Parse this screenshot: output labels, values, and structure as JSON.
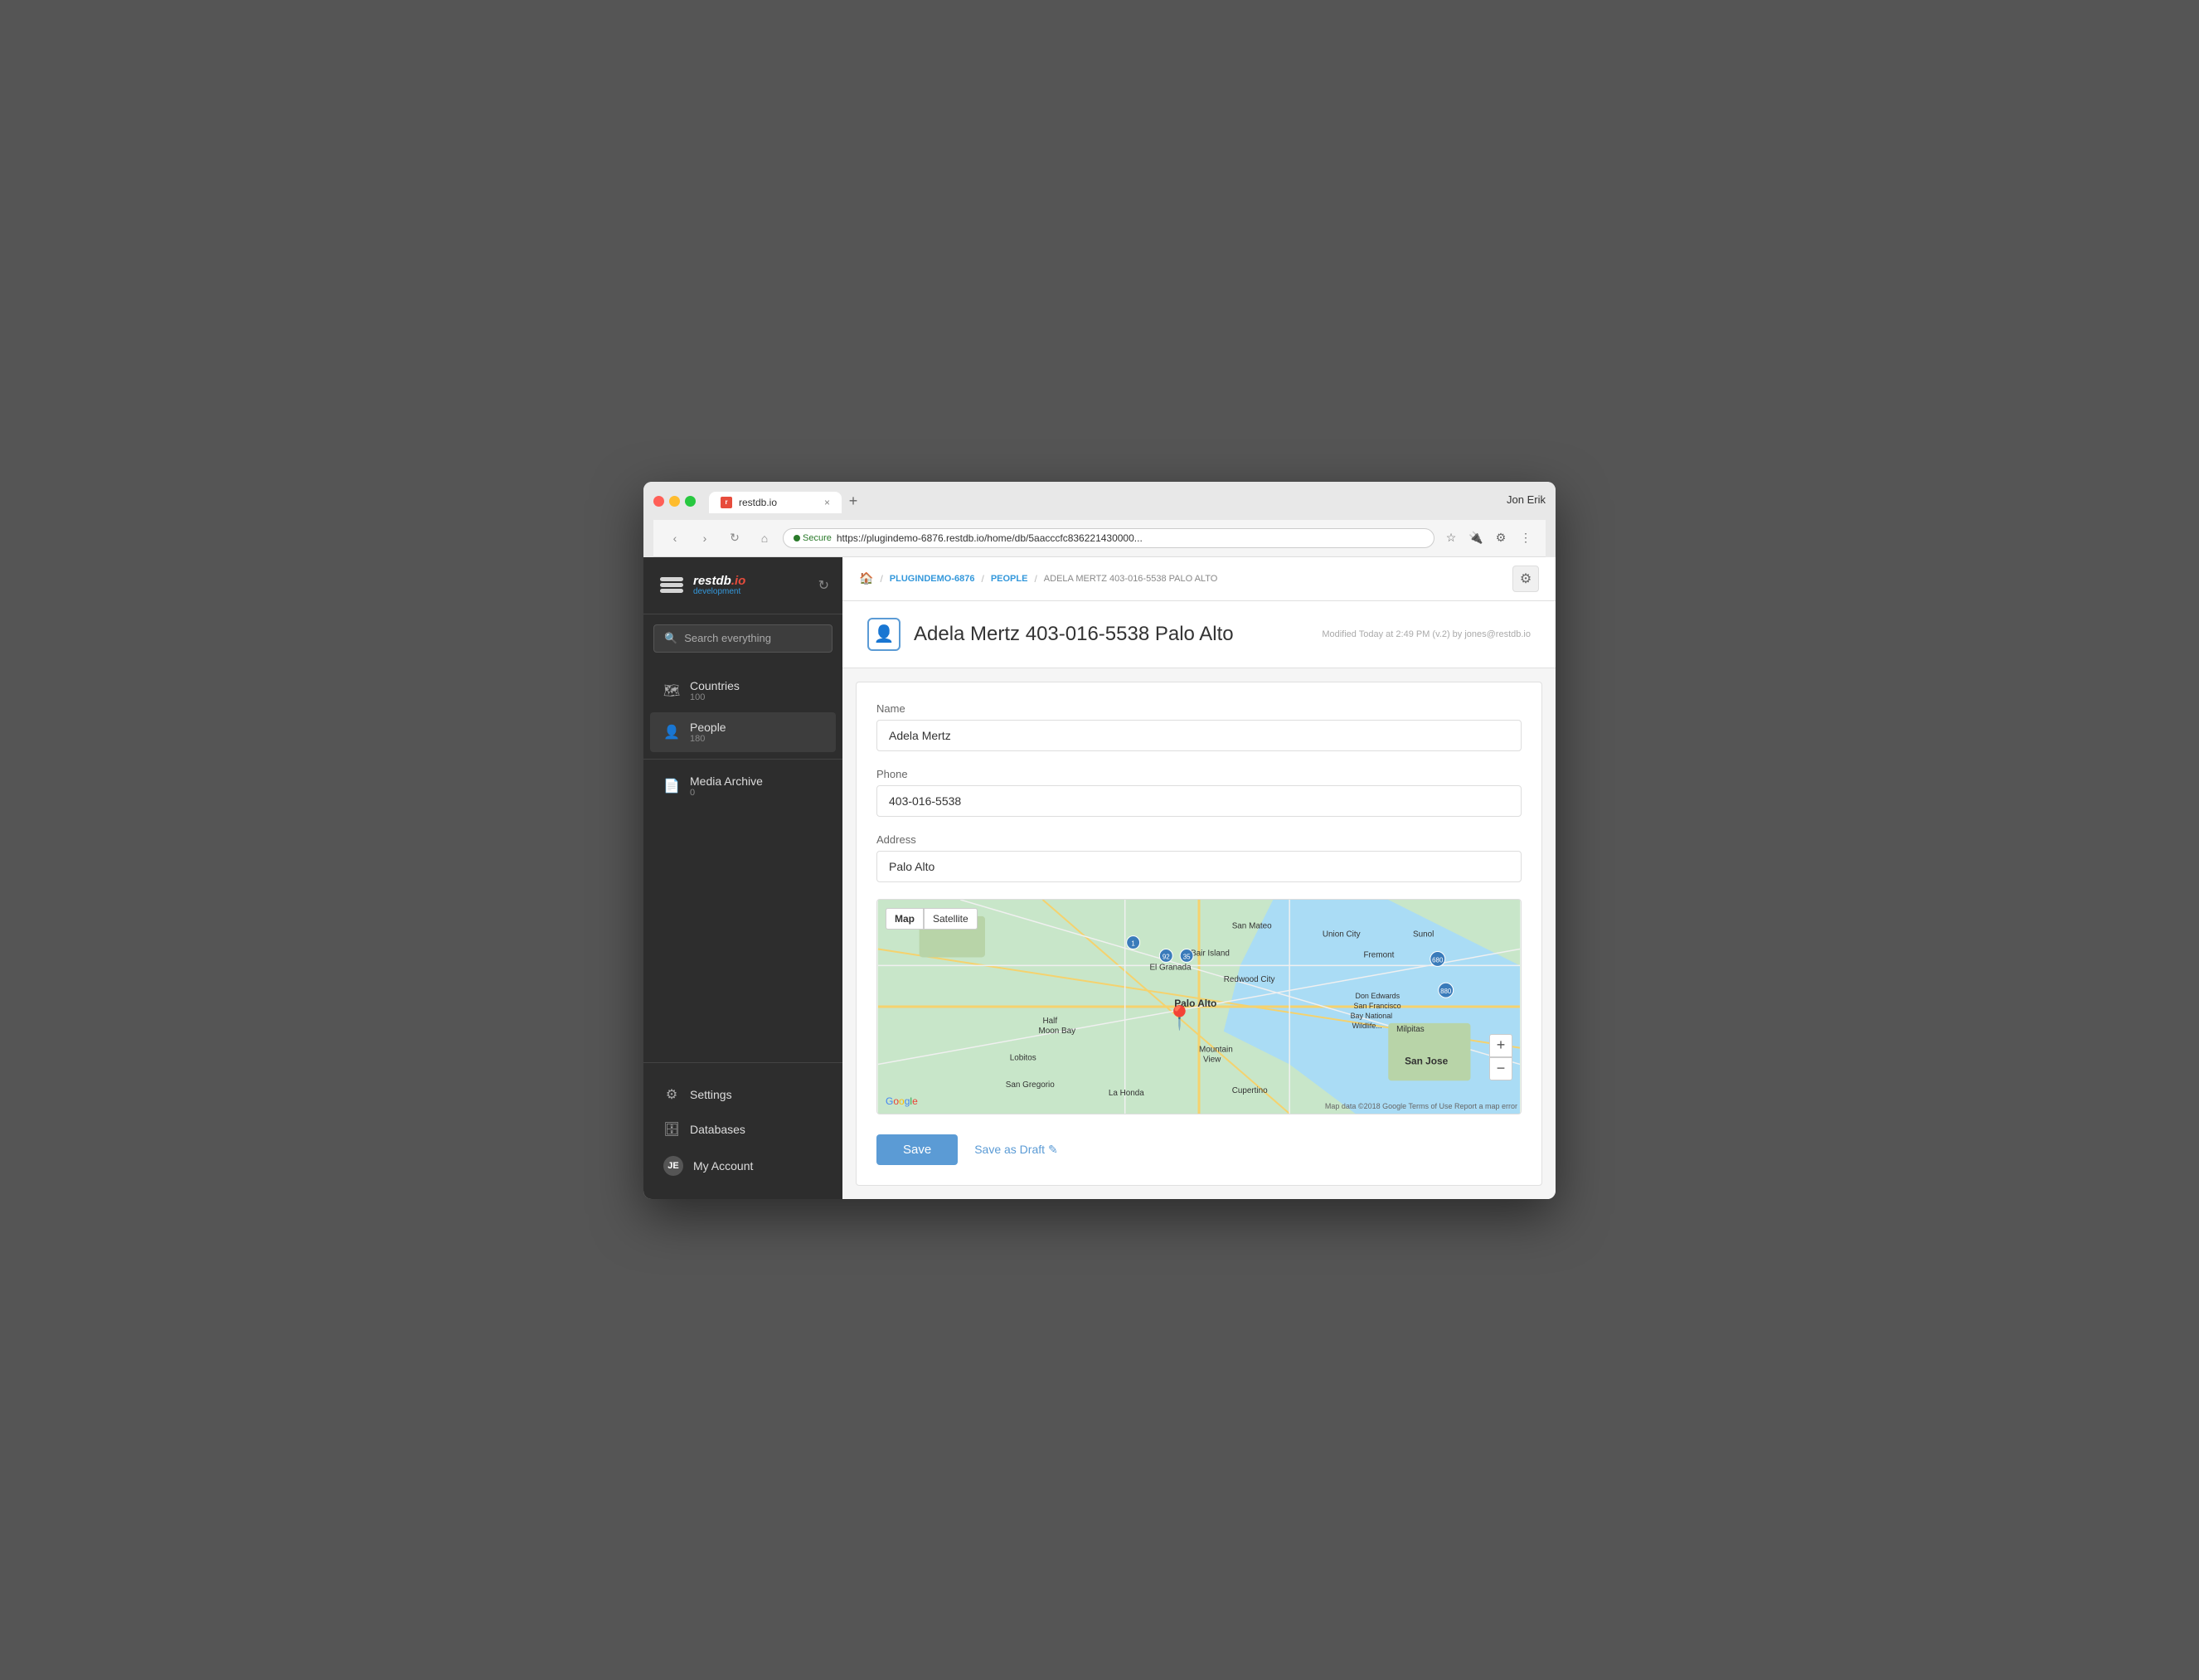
{
  "browser": {
    "user": "Jon Erik",
    "tab_title": "restdb.io",
    "url_secure": "Secure",
    "url": "https://plugindemo-6876.restdb.io/home/db/5aacccfc836221430000...",
    "new_tab_label": "+"
  },
  "breadcrumb": {
    "home_icon": "🏠",
    "db_link": "PLUGINDEMO-6876",
    "collection_link": "PEOPLE",
    "current": "ADELA MERTZ 403-016-5538 PALO ALTO"
  },
  "record": {
    "title": "Adela Mertz 403-016-5538 Palo Alto",
    "modified": "Modified Today at 2:49 PM (v.2) by jones@restdb.io"
  },
  "form": {
    "name_label": "Name",
    "name_value": "Adela Mertz",
    "name_placeholder": "Adela Mertz",
    "phone_label": "Phone",
    "phone_value": "403-016-5538",
    "phone_placeholder": "403-016-5538",
    "address_label": "Address",
    "address_value": "Palo Alto",
    "address_placeholder": "Palo Alto"
  },
  "map": {
    "btn_map": "Map",
    "btn_satellite": "Satellite",
    "zoom_in": "+",
    "zoom_out": "−",
    "google_logo": [
      "G",
      "o",
      "o",
      "g",
      "l",
      "e"
    ],
    "attribution": "Map data ©2018 Google  Terms of Use  Report a map error"
  },
  "actions": {
    "save_label": "Save",
    "draft_label": "Save as Draft",
    "draft_icon": "✎"
  },
  "sidebar": {
    "logo_text": "restdb",
    "logo_domain": ".io",
    "logo_sub": "development",
    "search_placeholder": "Search everything",
    "nav_items": [
      {
        "id": "countries",
        "label": "Countries",
        "count": "100",
        "icon": "🗺"
      },
      {
        "id": "people",
        "label": "People",
        "count": "180",
        "icon": "👤"
      }
    ],
    "media_label": "Media Archive",
    "media_count": "0",
    "media_icon": "📄",
    "settings_label": "Settings",
    "databases_label": "Databases",
    "account_label": "My Account"
  }
}
